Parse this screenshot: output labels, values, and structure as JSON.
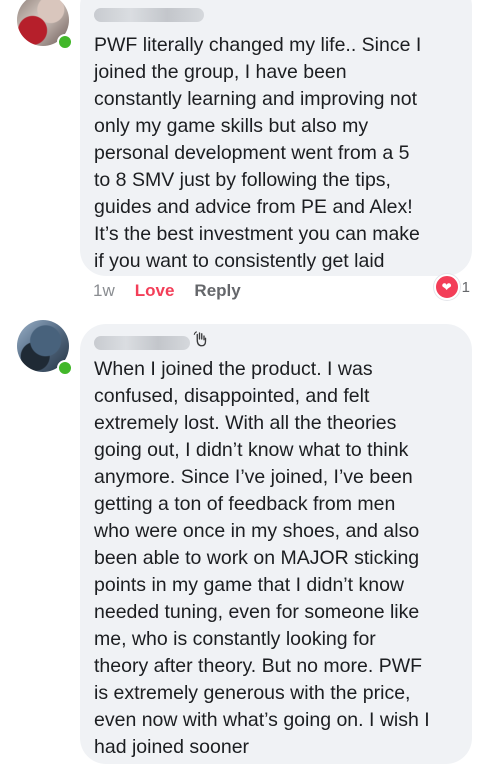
{
  "comments": [
    {
      "text": "PWF literally changed my life.. Since I joined the group, I have been constantly learning and improving not only my game skills but also my personal development went from a 5 to 8 SMV just by following the tips, guides and advice from PE and Alex! It’s the best investment you can make if you want to consistently get laid",
      "lines": [
        "PWF literally changed my life.. Since I",
        "joined the group, I have been",
        "constantly learning and improving not",
        "only my game skills but also my",
        "personal development went from a 5",
        "to 8 SMV just by following the tips,",
        "guides and advice from PE and Alex!",
        "It’s the best investment you can make",
        "if you want to consistently get laid"
      ],
      "meta": {
        "time": "1w",
        "love_label": "Love",
        "reply_label": "Reply"
      },
      "reaction": {
        "icon": "heart-icon",
        "count": "1",
        "color": "#f33e58"
      }
    },
    {
      "lines": [
        "When I joined the product. I was",
        "confused, disappointed, and felt",
        "extremely lost. With all the theories",
        "going out, I didn’t know what to think",
        "anymore. Since I’ve joined, I’ve been",
        "getting a ton of feedback from men",
        "who were once in my shoes, and also",
        "been able to work on MAJOR sticking",
        "points in my game that I didn’t know",
        "needed tuning, even for someone like",
        "me, who is constantly looking for",
        "theory after theory. But no more. PWF",
        "is extremely generous with the price,",
        "even now with what’s going on. I wish I",
        "had joined sooner"
      ],
      "badge_icon": "waving-hand-icon"
    }
  ],
  "colors": {
    "bubble": "#f0f2f5",
    "love": "#f33e58",
    "online": "#42b72a",
    "meta": "#65676b"
  }
}
